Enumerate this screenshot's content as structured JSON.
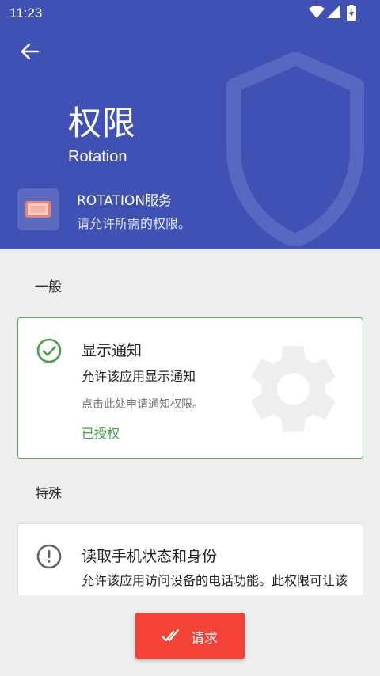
{
  "status_bar": {
    "time": "11:23",
    "icons": [
      "wifi-icon",
      "cell-signal-icon",
      "battery-charging-icon"
    ]
  },
  "header": {
    "title": "权限",
    "subtitle": "Rotation",
    "background_color": "#3f51b5",
    "service": {
      "name": "ROTATION服务",
      "description": "请允许所需的权限。"
    }
  },
  "sections": [
    {
      "label": "一般",
      "permission": {
        "title": "显示通知",
        "summary": "允许该应用显示通知",
        "hint": "点击此处申请通知权限。",
        "status": "已授权",
        "icon": "check-circle-icon",
        "status_color": "#43a047"
      }
    },
    {
      "label": "特殊",
      "permission": {
        "title": "读取手机状态和身份",
        "summary": "允许该应用访问设备的电话功能。此权限可让该应用确定本机号码和设备",
        "icon": "alert-circle-icon"
      }
    }
  ],
  "request_button": {
    "label": "请求",
    "icon": "double-check-icon",
    "color": "#f44336"
  }
}
